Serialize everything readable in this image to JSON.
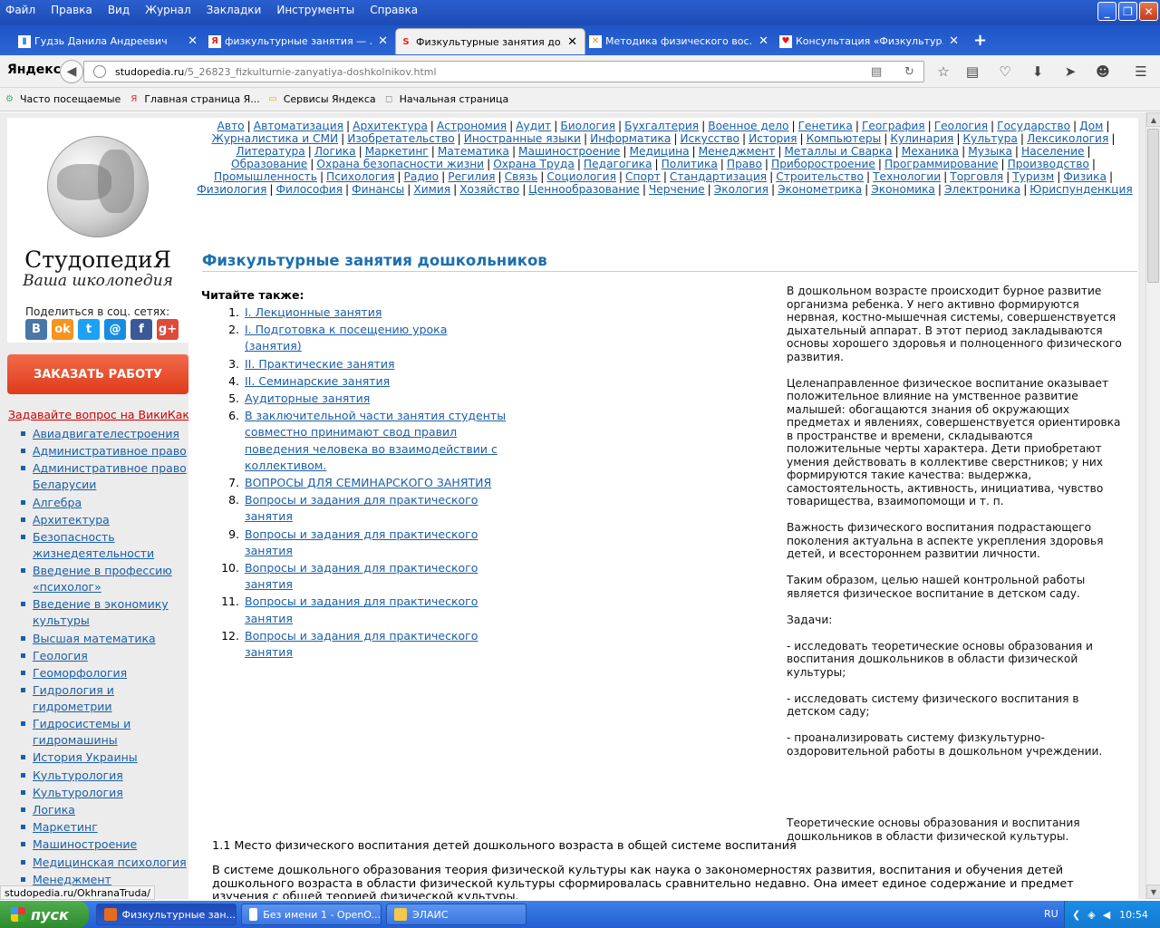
{
  "menu": [
    "Файл",
    "Правка",
    "Вид",
    "Журнал",
    "Закладки",
    "Инструменты",
    "Справка"
  ],
  "tabs": [
    {
      "title": "Гудзь Данила Андреевич",
      "icon": "book-icon"
    },
    {
      "title": "физкультурные занятия — ...",
      "icon": "yandex-icon"
    },
    {
      "title": "Физкультурные занятия до...",
      "icon": "studopedia-icon",
      "active": true
    },
    {
      "title": "Методика физического вос...",
      "icon": "joomla-icon"
    },
    {
      "title": "Консультация «Физкультур...",
      "icon": "heart-icon"
    }
  ],
  "new_tab_label": "+",
  "nav": {
    "brand": "Яндекс",
    "url_host": "studopedia.ru",
    "url_path": "/5_26823_fizkulturnie-zanyatiya-doshkolnikov.html"
  },
  "bookmarks": [
    "Часто посещаемые",
    "Главная страница Я...",
    "Сервисы Яндекса",
    "Начальная страница"
  ],
  "sidebar": {
    "logo_title": "СтудопедиЯ",
    "logo_subtitle": "Ваша школопедия",
    "share_label": "Поделиться в соц. сетях:",
    "share_icons": [
      {
        "name": "vk-icon",
        "glyph": "В",
        "color": "#4a76a8"
      },
      {
        "name": "odnoklassniki-icon",
        "glyph": "ok",
        "color": "#f7931e"
      },
      {
        "name": "twitter-icon",
        "glyph": "t",
        "color": "#1da1f2"
      },
      {
        "name": "mail-icon",
        "glyph": "@",
        "color": "#168de2"
      },
      {
        "name": "facebook-icon",
        "glyph": "f",
        "color": "#3b5998"
      },
      {
        "name": "googleplus-icon",
        "glyph": "g+",
        "color": "#dd4b39"
      }
    ],
    "order_button": "ЗАКАЗАТЬ РАБОТУ",
    "wikikak": "Задавайте вопрос на ВикиКак",
    "subjects": [
      "Авиадвигателестроения",
      "Административное право",
      "Административное право Беларусии",
      "Алгебра",
      "Архитектура",
      "Безопасность жизнедеятельности",
      "Введение в профессию «психолог»",
      "Введение в экономику культуры",
      "Высшая математика",
      "Геология",
      "Геоморфология",
      "Гидрология и гидрометрии",
      "Гидросистемы и гидромашины",
      "История Украины",
      "Культурология",
      "Культурология",
      "Логика",
      "Маркетинг",
      "Машиностроение",
      "Медицинская психология",
      "Менеджмент"
    ]
  },
  "top_nav": [
    "Авто",
    "Автоматизация",
    "Архитектура",
    "Астрономия",
    "Аудит",
    "Биология",
    "Бухгалтерия",
    "Военное дело",
    "Генетика",
    "География",
    "Геология",
    "Государство",
    "Дом",
    "Журналистика и СМИ",
    "Изобретательство",
    "Иностранные языки",
    "Информатика",
    "Искусство",
    "История",
    "Компьютеры",
    "Кулинария",
    "Культура",
    "Лексикология",
    "Литература",
    "Логика",
    "Маркетинг",
    "Математика",
    "Машиностроение",
    "Медицина",
    "Менеджмент",
    "Металлы и Сварка",
    "Механика",
    "Музыка",
    "Население",
    "Образование",
    "Охрана безопасности жизни",
    "Охрана Труда",
    "Педагогика",
    "Политика",
    "Право",
    "Приборостроение",
    "Программирование",
    "Производство",
    "Промышленность",
    "Психология",
    "Радио",
    "Регилия",
    "Связь",
    "Социология",
    "Спорт",
    "Стандартизация",
    "Строительство",
    "Технологии",
    "Торговля",
    "Туризм",
    "Физика",
    "Физиология",
    "Философия",
    "Финансы",
    "Химия",
    "Хозяйство",
    "Ценнообразование",
    "Черчение",
    "Экология",
    "Эконометрика",
    "Экономика",
    "Электроника",
    "Юриспунденкция"
  ],
  "article": {
    "title": "Физкультурные занятия дошкольников",
    "read_also": "Читайте также:",
    "related": [
      "I. Лекционные занятия",
      "I. Подготовка к посещению урока (занятия)",
      "II. Практические занятия",
      "II. Семинарские занятия",
      "Аудиторные занятия",
      "В заключительной части занятия студенты совместно принимают свод правил поведения человека во взаимодействии с коллективом.",
      "ВОПРОСЫ ДЛЯ СЕМИНАРСКОГО ЗАНЯТИЯ",
      "Вопросы и задания для практического занятия",
      "Вопросы и задания для практического занятия",
      "Вопросы и задания для практического занятия",
      "Вопросы и задания для практического занятия",
      "Вопросы и задания для практического занятия"
    ],
    "right_paragraphs": [
      "В дошкольном возрасте происходит бурное развитие организма ребенка. У него активно формируются нервная, костно-мышечная системы, совершенствуется дыхательный аппарат. В этот период закладываются основы хорошего здоровья и полноценного физического развития.",
      "Целенаправленное физическое воспитание оказывает положительное влияние на умственное развитие малышей: обогащаются знания об окружающих предметах и явлениях, совершенствуется ориентировка в пространстве и времени, складываются положительные черты характера. Дети приобретают умения действовать в коллективе сверстников; у них формируются такие качества: выдержка, самостоятельность, активность, инициатива, чувство товарищества, взаимопомощи и т. п.",
      "Важность физического воспитания подрастающего поколения актуальна в аспекте укрепления здоровья детей, и всестороннем развитии личности.",
      "Таким образом, целью нашей контрольной работы является физическое воспитание в детском саду.",
      "Задачи:",
      "- исследовать теоретические основы образования и воспитания дошкольников в области физической культуры;",
      "- исследовать систему физического воспитания в детском саду;",
      "- проанализировать систему физкультурно-оздоровительной работы в дошкольном учреждении.",
      "",
      "Теоретические основы образования и воспитания дошкольников в области физической культуры."
    ],
    "section_heading": "1.1 Место физического воспитания детей дошкольного возраста в общей системе воспитания",
    "body": "В системе дошкольного образования теория физической культуры как наука о закономерностях развития, воспитания и обучения детей дошкольного возраста в области физической культуры сформировалась сравнительно недавно. Она имеет единое содержание и предмет изучения с общей теорией физической культуры."
  },
  "status_url": "studopedia.ru/OkhranaTruda/",
  "taskbar": {
    "start": "пуск",
    "tasks": [
      "Физкультурные зан...",
      "Без имени 1 - OpenO...",
      "ЭЛАИС"
    ],
    "lang": "RU",
    "time": "10:54"
  }
}
